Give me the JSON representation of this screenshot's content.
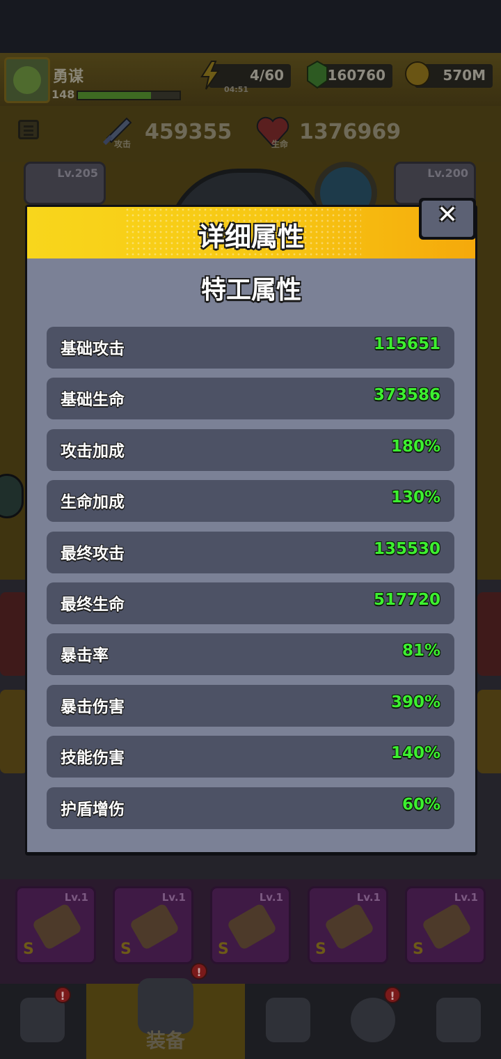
{
  "header": {
    "player_name": "勇谋",
    "player_level": "148",
    "xp_progress": 0.72,
    "energy": {
      "value": "4/60",
      "timer": "04:51",
      "icon": "lightning-plus-icon"
    },
    "gems": {
      "value": "160760",
      "icon": "green-gem-plus-icon"
    },
    "coins": {
      "value": "570M",
      "icon": "gold-coin-plus-icon"
    }
  },
  "power": {
    "attack_value": "459355",
    "attack_label": "攻击",
    "hp_value": "1376969",
    "hp_label": "生命"
  },
  "slots": {
    "left_level": "Lv.205",
    "right_level": "Lv.200"
  },
  "equipment": [
    {
      "level": "Lv.1",
      "grade": "S",
      "icon": "dagger-icon"
    },
    {
      "level": "Lv.1",
      "grade": "S",
      "icon": "dagger-icon"
    },
    {
      "level": "Lv.1",
      "grade": "S",
      "icon": "water-gun-icon"
    },
    {
      "level": "Lv.1",
      "grade": "S",
      "icon": "shuriken-icon"
    },
    {
      "level": "Lv.1",
      "grade": "S",
      "icon": "shuriken-icon"
    }
  ],
  "nav": {
    "tabs": [
      {
        "icon": "shop-icon",
        "badge": "!"
      },
      {
        "icon": "equip-badge-icon",
        "label": "装备",
        "badge": "!"
      },
      {
        "icon": "crossed-swords-star-icon"
      },
      {
        "icon": "stars-orb-icon",
        "badge": "!"
      },
      {
        "icon": "dna-capsule-icon"
      }
    ]
  },
  "modal": {
    "title": "详细属性",
    "close_label": "✕",
    "section_title": "特工属性",
    "stats": [
      {
        "label": "基础攻击",
        "value": "115651"
      },
      {
        "label": "基础生命",
        "value": "373586"
      },
      {
        "label": "攻击加成",
        "value": "180%"
      },
      {
        "label": "生命加成",
        "value": "130%"
      },
      {
        "label": "最终攻击",
        "value": "135530"
      },
      {
        "label": "最终生命",
        "value": "517720"
      },
      {
        "label": "暴击率",
        "value": "81%"
      },
      {
        "label": "暴击伤害",
        "value": "390%"
      },
      {
        "label": "技能伤害",
        "value": "140%"
      },
      {
        "label": "护盾增伤",
        "value": "60%"
      }
    ]
  },
  "colors": {
    "header_yellow": "#f8d61c",
    "header_orange": "#f5a90b",
    "panel_body": "#7b8196",
    "row_bg": "#4d5265",
    "value_green": "#3df030"
  }
}
